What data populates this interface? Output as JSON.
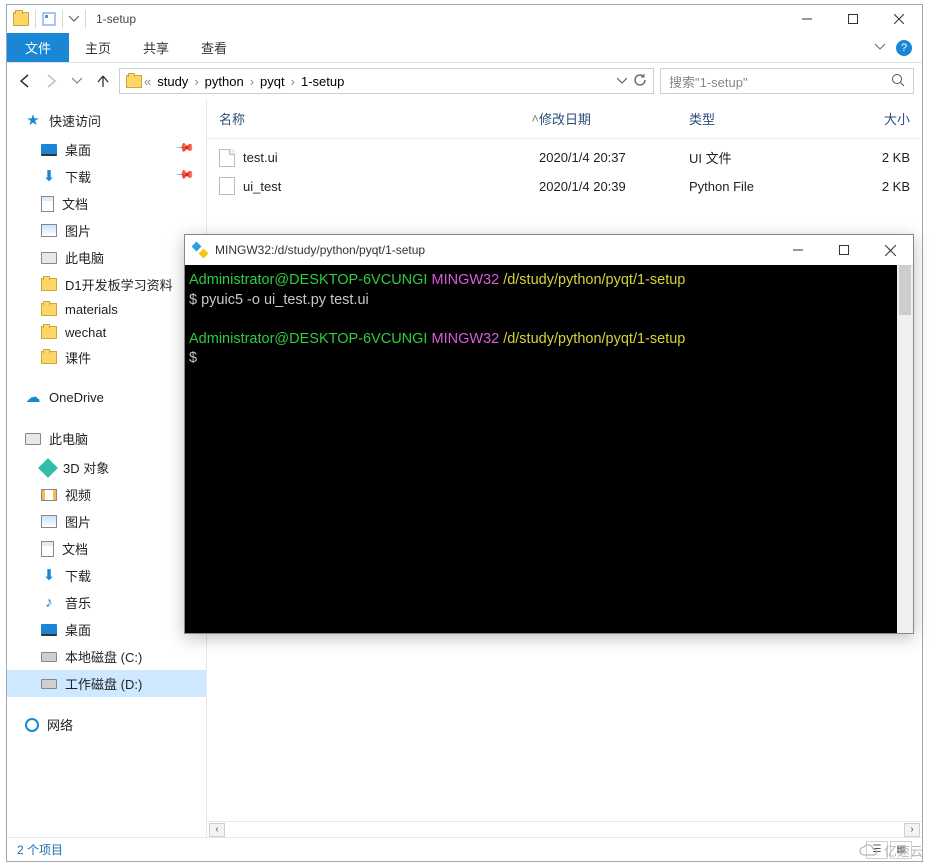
{
  "explorer": {
    "window_title": "1-setup",
    "tabs": {
      "file": "文件",
      "home": "主页",
      "share": "共享",
      "view": "查看"
    },
    "breadcrumb": [
      "study",
      "python",
      "pyqt",
      "1-setup"
    ],
    "search_placeholder": "搜索\"1-setup\"",
    "columns": {
      "name": "名称",
      "date": "修改日期",
      "type": "类型",
      "size": "大小"
    },
    "files": [
      {
        "name": "test.ui",
        "date": "2020/1/4 20:37",
        "type": "UI 文件",
        "size": "2 KB",
        "icon": "file"
      },
      {
        "name": "ui_test",
        "date": "2020/1/4 20:39",
        "type": "Python File",
        "size": "2 KB",
        "icon": "py"
      }
    ],
    "status": "2 个项目",
    "sidebar": {
      "quick": {
        "label": "快速访问",
        "items": [
          {
            "label": "桌面",
            "icon": "desktop",
            "pin": true
          },
          {
            "label": "下载",
            "icon": "down",
            "pin": true
          },
          {
            "label": "文档",
            "icon": "doc"
          },
          {
            "label": "图片",
            "icon": "pic"
          },
          {
            "label": "此电脑",
            "icon": "pc"
          },
          {
            "label": "D1开发板学习资料",
            "icon": "folder"
          },
          {
            "label": "materials",
            "icon": "folder"
          },
          {
            "label": "wechat",
            "icon": "folder"
          },
          {
            "label": "课件",
            "icon": "folder"
          }
        ]
      },
      "onedrive": {
        "label": "OneDrive"
      },
      "thispc": {
        "label": "此电脑",
        "items": [
          {
            "label": "3D 对象",
            "icon": "obj3d"
          },
          {
            "label": "视频",
            "icon": "video"
          },
          {
            "label": "图片",
            "icon": "pic"
          },
          {
            "label": "文档",
            "icon": "doc"
          },
          {
            "label": "下载",
            "icon": "down"
          },
          {
            "label": "音乐",
            "icon": "music"
          },
          {
            "label": "桌面",
            "icon": "desktop"
          },
          {
            "label": "本地磁盘 (C:)",
            "icon": "drive"
          },
          {
            "label": "工作磁盘 (D:)",
            "icon": "drive",
            "selected": true
          }
        ]
      },
      "network": {
        "label": "网络"
      }
    }
  },
  "terminal": {
    "title": "MINGW32:/d/study/python/pyqt/1-setup",
    "prompt_user": "Administrator@DESKTOP-6VCUNGI",
    "prompt_env": "MINGW32",
    "prompt_path": "/d/study/python/pyqt/1-setup",
    "command": "pyuic5 -o ui_test.py test.ui",
    "ps1": "$"
  },
  "watermark": "亿速云"
}
